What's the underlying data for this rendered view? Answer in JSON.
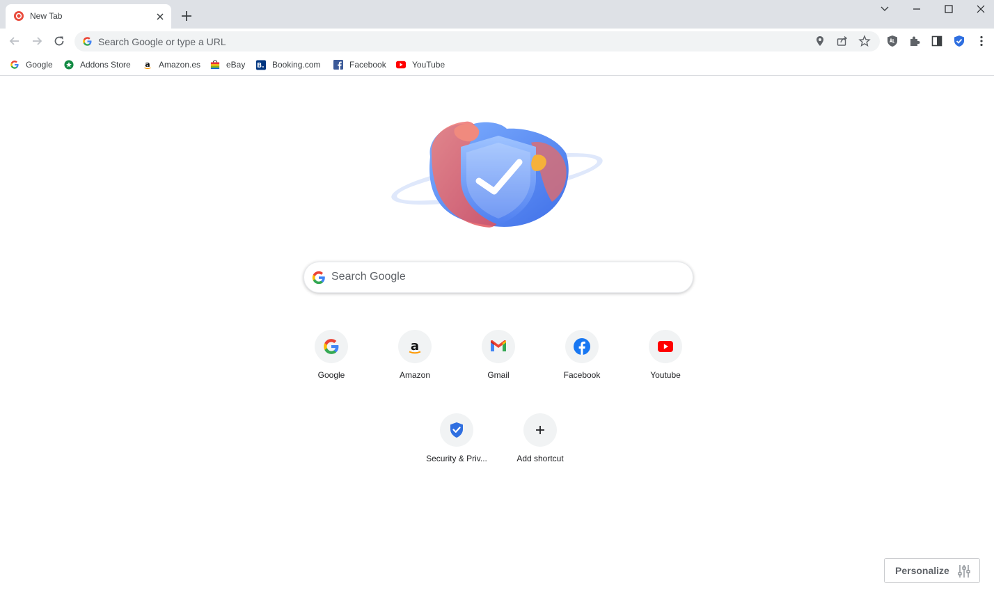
{
  "tab": {
    "title": "New Tab"
  },
  "omnibox": {
    "placeholder": "Search Google or type a URL"
  },
  "bookmarks": [
    {
      "label": "Google",
      "icon": "google-icon"
    },
    {
      "label": "Addons Store",
      "icon": "addons-store-icon"
    },
    {
      "label": "Amazon.es",
      "icon": "amazon-icon"
    },
    {
      "label": "eBay",
      "icon": "ebay-icon"
    },
    {
      "label": "Booking.com",
      "icon": "booking-icon"
    },
    {
      "label": "Facebook",
      "icon": "facebook-icon"
    },
    {
      "label": "YouTube",
      "icon": "youtube-icon"
    }
  ],
  "search": {
    "placeholder": "Search Google"
  },
  "shortcuts": [
    {
      "label": "Google",
      "icon": "google-icon"
    },
    {
      "label": "Amazon",
      "icon": "amazon-icon"
    },
    {
      "label": "Gmail",
      "icon": "gmail-icon"
    },
    {
      "label": "Facebook",
      "icon": "facebook-icon"
    },
    {
      "label": "Youtube",
      "icon": "youtube-icon"
    },
    {
      "label": "Security & Priv...",
      "icon": "shield-check-icon"
    },
    {
      "label": "Add shortcut",
      "icon": "plus-icon"
    }
  ],
  "personalize": {
    "label": "Personalize"
  },
  "colors": {
    "accent_blue": "#1a73e8",
    "tabstrip_bg": "#dee1e6",
    "omnibox_bg": "#f1f3f4",
    "facebook_blue": "#1877f2",
    "youtube_red": "#ff0000"
  }
}
